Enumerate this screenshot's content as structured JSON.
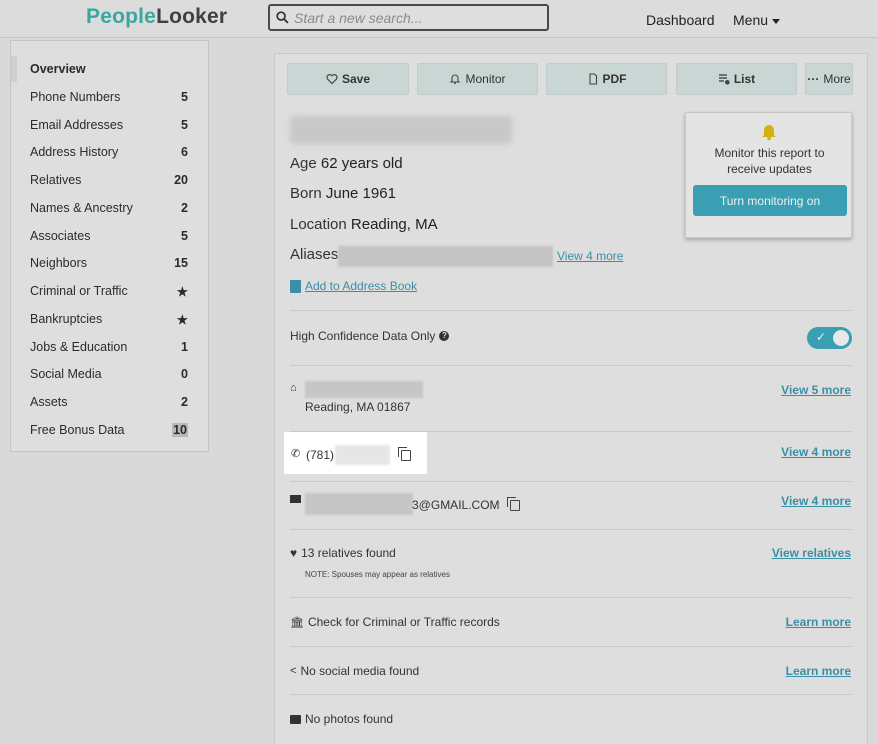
{
  "header": {
    "logo_part1": "People",
    "logo_part2": "Looker",
    "search_placeholder": "Start a new search...",
    "nav_dashboard": "Dashboard",
    "nav_menu": "Menu"
  },
  "sidebar": {
    "items": [
      {
        "label": "Overview",
        "count": ""
      },
      {
        "label": "Phone Numbers",
        "count": "5"
      },
      {
        "label": "Email Addresses",
        "count": "5"
      },
      {
        "label": "Address History",
        "count": "6"
      },
      {
        "label": "Relatives",
        "count": "20"
      },
      {
        "label": "Names & Ancestry",
        "count": "2"
      },
      {
        "label": "Associates",
        "count": "5"
      },
      {
        "label": "Neighbors",
        "count": "15"
      },
      {
        "label": "Criminal or Traffic",
        "count": "★"
      },
      {
        "label": "Bankruptcies",
        "count": "★"
      },
      {
        "label": "Jobs & Education",
        "count": "1"
      },
      {
        "label": "Social Media",
        "count": "0"
      },
      {
        "label": "Assets",
        "count": "2"
      },
      {
        "label": "Free Bonus Data",
        "count": "10"
      }
    ]
  },
  "actions": {
    "save": "Save",
    "monitor": "Monitor",
    "pdf": "PDF",
    "list": "List",
    "more": "More"
  },
  "profile": {
    "age_label": "Age",
    "age_value": "62 years old",
    "born_label": "Born",
    "born_value": "June 1961",
    "location_label": "Location",
    "location_value": "Reading, MA",
    "aliases_label": "Aliases",
    "aliases_more": "View 4 more",
    "add_book": "Add to Address Book"
  },
  "popup": {
    "text": "Monitor this report to receive updates",
    "button": "Turn monitoring on"
  },
  "rows": {
    "confidence": "High Confidence Data Only",
    "address_city": "Reading, MA 01867",
    "address_more": "View 5 more",
    "phone_prefix": "(781)",
    "phone_more": "View 4 more",
    "email_suffix": "3@GMAIL.COM",
    "email_more": "View 4 more",
    "relatives": "13 relatives found",
    "relatives_note": "NOTE: Spouses may appear as relatives",
    "relatives_link": "View relatives",
    "criminal": "Check for Criminal or Traffic records",
    "criminal_link": "Learn more",
    "social": "No social media found",
    "social_link": "Learn more",
    "photos": "No photos found"
  },
  "colors": {
    "brand_teal": "#3aa7a0",
    "accent_blue": "#3a9fb3",
    "link": "#3a8fa6"
  }
}
